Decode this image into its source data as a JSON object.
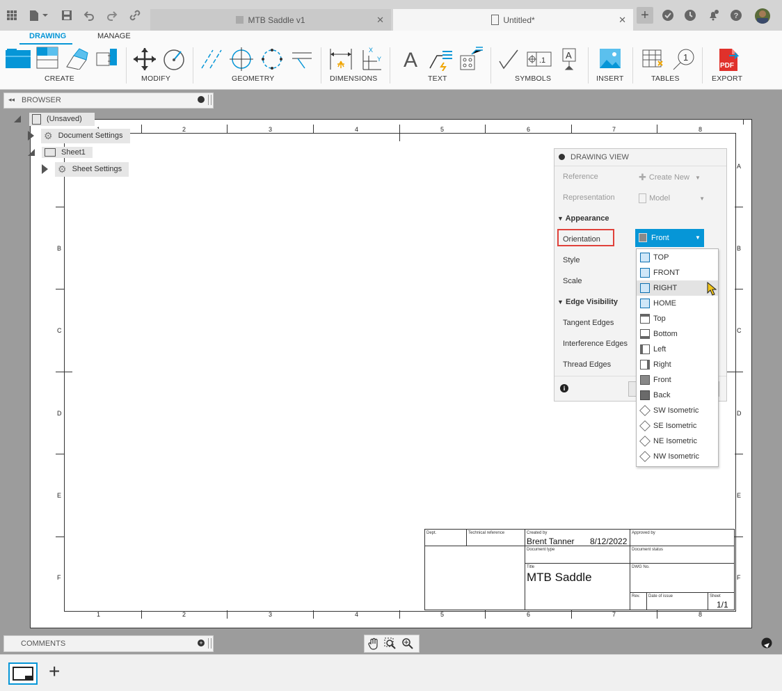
{
  "tabs": [
    {
      "label": "MTB Saddle v1",
      "active": false
    },
    {
      "label": "Untitled*",
      "active": true
    }
  ],
  "ribbon": {
    "tabs": [
      "DRAWING",
      "MANAGE"
    ],
    "groups": [
      "CREATE",
      "MODIFY",
      "GEOMETRY",
      "DIMENSIONS",
      "TEXT",
      "SYMBOLS",
      "INSERT",
      "TABLES",
      "EXPORT"
    ],
    "pdf_label": "PDF",
    "text_glyph": "A",
    "balloon_glyph": "1"
  },
  "browser": {
    "title": "BROWSER",
    "root": "(Unsaved)",
    "items": [
      "Document Settings",
      "Sheet1",
      "Sheet Settings"
    ]
  },
  "sheet": {
    "col_labels": [
      "1",
      "2",
      "3",
      "4",
      "5",
      "6",
      "7",
      "8"
    ],
    "row_labels": [
      "A",
      "B",
      "C",
      "D",
      "E",
      "F"
    ]
  },
  "dialog": {
    "title": "DRAWING VIEW",
    "reference_label": "Reference",
    "reference_value": "Create New",
    "representation_label": "Representation",
    "representation_value": "Model",
    "appearance_header": "Appearance",
    "orientation_label": "Orientation",
    "orientation_value": "Front",
    "style_label": "Style",
    "scale_label": "Scale",
    "edge_header": "Edge Visibility",
    "tangent_label": "Tangent Edges",
    "interference_label": "Interference Edges",
    "thread_label": "Thread Edges"
  },
  "orientation_options": [
    "TOP",
    "FRONT",
    "RIGHT",
    "HOME",
    "Top",
    "Bottom",
    "Left",
    "Right",
    "Front",
    "Back",
    "SW Isometric",
    "SE Isometric",
    "NE Isometric",
    "NW Isometric"
  ],
  "highlighted_option": "RIGHT",
  "title_block": {
    "dept_label": "Dept.",
    "techref_label": "Technical reference",
    "created_label": "Created by",
    "created_by": "Brent Tanner",
    "date": "8/12/2022",
    "approved_label": "Approved by",
    "doctype_label": "Document type",
    "docstatus_label": "Document status",
    "title_label": "Title",
    "title": "MTB Saddle",
    "dwg_label": "DWG No.",
    "rev_label": "Rev.",
    "issue_label": "Date of issue",
    "sheet_label": "Sheet",
    "sheet_value": "1/1"
  },
  "comments": {
    "title": "COMMENTS"
  },
  "colors": {
    "accent": "#0696d7",
    "highlight_border": "#e0413a",
    "pdf_red": "#e0312b"
  }
}
